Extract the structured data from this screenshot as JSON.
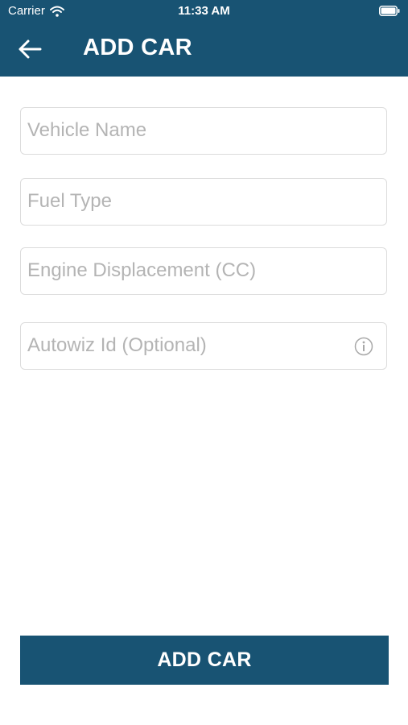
{
  "status_bar": {
    "carrier": "Carrier",
    "time": "11:33 AM",
    "wifi_icon": "wifi-icon",
    "battery_icon": "battery-full-icon"
  },
  "nav": {
    "back_icon": "arrow-left-icon",
    "title": "ADD CAR"
  },
  "form": {
    "fields": [
      {
        "placeholder": "Vehicle Name",
        "value": ""
      },
      {
        "placeholder": "Fuel Type",
        "value": ""
      },
      {
        "placeholder": "Engine Displacement (CC)",
        "value": ""
      },
      {
        "placeholder": "Autowiz Id (Optional)",
        "value": "",
        "icon": "info-icon"
      }
    ]
  },
  "submit_button": {
    "label": "ADD CAR"
  },
  "colors": {
    "primary": "#185373",
    "field_border": "#dcdcdc",
    "placeholder": "#b4b4b4",
    "background": "#ffffff"
  }
}
